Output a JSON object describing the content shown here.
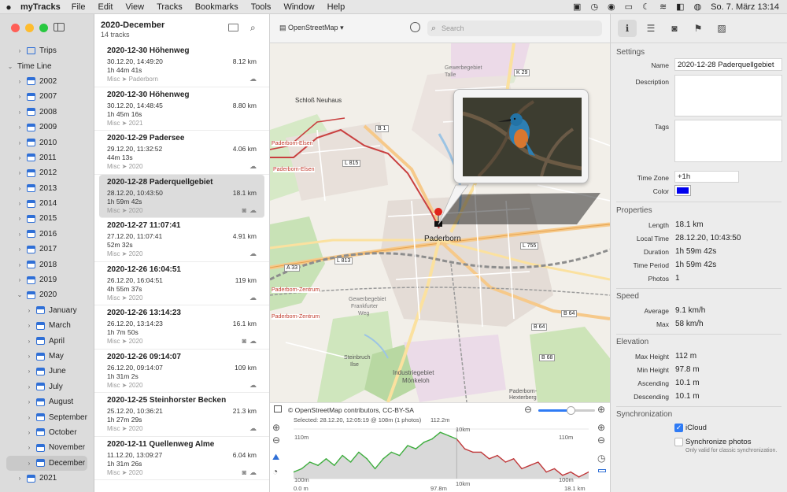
{
  "menubar": {
    "app_name": "myTracks",
    "items": [
      "File",
      "Edit",
      "View",
      "Tracks",
      "Bookmarks",
      "Tools",
      "Window",
      "Help"
    ],
    "clock": "So. 7. März  13:14"
  },
  "sidebar": {
    "items": [
      {
        "label": "Trips",
        "level": 1,
        "icon": "folder",
        "expanded": false
      },
      {
        "label": "Time Line",
        "level": 0,
        "icon": "none",
        "expanded": true
      },
      {
        "label": "2002",
        "level": 1,
        "icon": "calendar",
        "expanded": false
      },
      {
        "label": "2007",
        "level": 1,
        "icon": "calendar",
        "expanded": false
      },
      {
        "label": "2008",
        "level": 1,
        "icon": "calendar",
        "expanded": false
      },
      {
        "label": "2009",
        "level": 1,
        "icon": "calendar",
        "expanded": false
      },
      {
        "label": "2010",
        "level": 1,
        "icon": "calendar",
        "expanded": false
      },
      {
        "label": "2011",
        "level": 1,
        "icon": "calendar",
        "expanded": false
      },
      {
        "label": "2012",
        "level": 1,
        "icon": "calendar",
        "expanded": false
      },
      {
        "label": "2013",
        "level": 1,
        "icon": "calendar",
        "expanded": false
      },
      {
        "label": "2014",
        "level": 1,
        "icon": "calendar",
        "expanded": false
      },
      {
        "label": "2015",
        "level": 1,
        "icon": "calendar",
        "expanded": false
      },
      {
        "label": "2016",
        "level": 1,
        "icon": "calendar",
        "expanded": false
      },
      {
        "label": "2017",
        "level": 1,
        "icon": "calendar",
        "expanded": false
      },
      {
        "label": "2018",
        "level": 1,
        "icon": "calendar",
        "expanded": false
      },
      {
        "label": "2019",
        "level": 1,
        "icon": "calendar",
        "expanded": false
      },
      {
        "label": "2020",
        "level": 1,
        "icon": "calendar",
        "expanded": true
      },
      {
        "label": "January",
        "level": 2,
        "icon": "calendar",
        "expanded": false
      },
      {
        "label": "March",
        "level": 2,
        "icon": "calendar",
        "expanded": false
      },
      {
        "label": "April",
        "level": 2,
        "icon": "calendar",
        "expanded": false
      },
      {
        "label": "May",
        "level": 2,
        "icon": "calendar",
        "expanded": false
      },
      {
        "label": "June",
        "level": 2,
        "icon": "calendar",
        "expanded": false
      },
      {
        "label": "July",
        "level": 2,
        "icon": "calendar",
        "expanded": false
      },
      {
        "label": "August",
        "level": 2,
        "icon": "calendar",
        "expanded": false
      },
      {
        "label": "September",
        "level": 2,
        "icon": "calendar",
        "expanded": false
      },
      {
        "label": "October",
        "level": 2,
        "icon": "calendar",
        "expanded": false
      },
      {
        "label": "November",
        "level": 2,
        "icon": "calendar",
        "expanded": false
      },
      {
        "label": "December",
        "level": 2,
        "icon": "calendar",
        "expanded": false,
        "selected": true
      },
      {
        "label": "2021",
        "level": 1,
        "icon": "calendar",
        "expanded": false
      }
    ]
  },
  "list": {
    "title": "2020-December",
    "subtitle": "14 tracks",
    "tracks": [
      {
        "name": "2020-12-30 Höhenweg",
        "date": "30.12.20, 14:49:20",
        "duration": "1h 44m 41s",
        "category": "Misc ➤ Paderborn",
        "distance": "8.12 km",
        "icons": "cloud"
      },
      {
        "name": "2020-12-30 Höhenweg",
        "date": "30.12.20, 14:48:45",
        "duration": "1h 45m 16s",
        "category": "Misc ➤ 2021",
        "distance": "8.80 km",
        "icons": ""
      },
      {
        "name": "2020-12-29 Padersee",
        "date": "29.12.20, 11:32:52",
        "duration": "44m 13s",
        "category": "Misc ➤ 2020",
        "distance": "4.06 km",
        "icons": "cloud"
      },
      {
        "name": "2020-12-28 Paderquellgebiet",
        "date": "28.12.20, 10:43:50",
        "duration": "1h 59m 42s",
        "category": "Misc ➤ 2020",
        "distance": "18.1 km",
        "icons": "camera cloud",
        "selected": true
      },
      {
        "name": "2020-12-27 11:07:41",
        "date": "27.12.20, 11:07:41",
        "duration": "52m 32s",
        "category": "Misc ➤ 2020",
        "distance": "4.91 km",
        "icons": "cloud"
      },
      {
        "name": "2020-12-26 16:04:51",
        "date": "26.12.20, 16:04:51",
        "duration": "4h 55m 37s",
        "category": "Misc ➤ 2020",
        "distance": "119 km",
        "icons": "cloud"
      },
      {
        "name": "2020-12-26 13:14:23",
        "date": "26.12.20, 13:14:23",
        "duration": "1h 7m 50s",
        "category": "Misc ➤ 2020",
        "distance": "16.1 km",
        "icons": "camera cloud"
      },
      {
        "name": "2020-12-26 09:14:07",
        "date": "26.12.20, 09:14:07",
        "duration": "1h 31m 2s",
        "category": "Misc ➤ 2020",
        "distance": "109 km",
        "icons": "cloud"
      },
      {
        "name": "2020-12-25 Steinhorster Becken",
        "date": "25.12.20, 10:36:21",
        "duration": "1h 27m 29s",
        "category": "Misc ➤ 2020",
        "distance": "21.3 km",
        "icons": "cloud"
      },
      {
        "name": "2020-12-11 Quellenweg Alme",
        "date": "11.12.20, 13:09:27",
        "duration": "1h 31m 26s",
        "category": "Misc ➤ 2020",
        "distance": "6.04 km",
        "icons": "camera cloud"
      }
    ]
  },
  "map": {
    "provider": "OpenStreetMap",
    "search_placeholder": "Search",
    "attribution": "© OpenStreetMap contributors, CC-BY-SA",
    "labels": {
      "schloss": "Schloß Neuhaus",
      "gewerbe1": "Gewerbegebiet",
      "gewerbe1b": "Talle",
      "paderborn": "Paderborn",
      "elsen1": "Paderborn-Elsen",
      "elsen2": "Paderborn-Elsen",
      "zentrum1": "Paderborn-Zentrum",
      "zentrum2": "Paderborn-Zentrum",
      "gewerbe2": "Gewerbegebiet",
      "gewerbe2b": "Frankfurter",
      "gewerbe2c": "Weg",
      "steinbruch": "Steinbruch",
      "steinbruch2": "Ilse",
      "industrie": "Industriegebiet",
      "industrie2": "Mönkeloh",
      "hexenberg": "Paderborn-",
      "hexenberg2": "Hexterberg",
      "k29": "K 29",
      "b1": "B 1",
      "l815": "L 815",
      "l755": "L 755",
      "a33": "A 33",
      "l813": "L 813",
      "b64a": "B 64",
      "b64b": "B 64",
      "b68": "B 68"
    }
  },
  "elevation": {
    "selected": "Selected: 28.12.20, 12:05:19 @ 108m (1 photos)",
    "peak": "112.2m",
    "y_top_left": "110m",
    "y_top_right": "110m",
    "y_bottom_left": "100m",
    "y_bottom_right": "100m",
    "marker_top": "10km",
    "marker_bottom": "10km",
    "x_start": "0.0 m",
    "x_mid": "97.8m",
    "x_end": "18.1 km",
    "colors": {
      "up": "#3fae3f",
      "down": "#c0393b",
      "fill": "#d9d9d9"
    },
    "chart_data": {
      "type": "area",
      "xlabel": "",
      "ylabel": "",
      "xlim": [
        0,
        18.1
      ],
      "ylim": [
        98,
        113
      ],
      "x": [
        0,
        0.5,
        1,
        1.5,
        2,
        2.5,
        3,
        3.5,
        4,
        4.5,
        5,
        5.5,
        6,
        6.5,
        7,
        7.5,
        8,
        8.5,
        9,
        9.5,
        10,
        10.5,
        11,
        11.5,
        12,
        12.5,
        13,
        13.5,
        14,
        14.5,
        15,
        15.5,
        16,
        16.5,
        17,
        17.5,
        18.1
      ],
      "values": [
        100,
        101,
        103,
        102,
        104,
        102,
        105,
        103,
        106,
        104,
        101,
        104,
        106,
        105,
        108,
        107,
        109,
        110,
        112,
        111,
        110,
        107,
        106,
        106,
        104,
        105,
        103,
        104,
        101,
        102,
        103,
        100,
        101,
        99,
        100,
        98.5,
        100
      ]
    }
  },
  "inspector": {
    "tabs": [
      "info",
      "list",
      "camera",
      "flag",
      "photos"
    ],
    "settings_title": "Settings",
    "name_label": "Name",
    "name_value": "2020-12-28 Paderquellgebiet",
    "description_label": "Description",
    "tags_label": "Tags",
    "timezone_label": "Time Zone",
    "timezone_value": "+1h",
    "color_label": "Color",
    "track_color": "#0000ee",
    "properties_title": "Properties",
    "properties": [
      {
        "label": "Length",
        "value": "18.1 km"
      },
      {
        "label": "Local Time",
        "value": "28.12.20, 10:43:50"
      },
      {
        "label": "Duration",
        "value": "1h 59m 42s"
      },
      {
        "label": "Time Period",
        "value": "1h 59m 42s"
      },
      {
        "label": "Photos",
        "value": "1"
      }
    ],
    "speed_title": "Speed",
    "speed": [
      {
        "label": "Average",
        "value": "9.1 km/h"
      },
      {
        "label": "Max",
        "value": "58 km/h"
      }
    ],
    "elevation_title": "Elevation",
    "elevation": [
      {
        "label": "Max Height",
        "value": "112 m"
      },
      {
        "label": "Min Height",
        "value": "97.8 m"
      },
      {
        "label": "Ascending",
        "value": "10.1 m"
      },
      {
        "label": "Descending",
        "value": "10.1 m"
      }
    ],
    "sync_title": "Synchronization",
    "icloud_label": "iCloud",
    "icloud_checked": true,
    "sync_photos_label": "Synchronize photos",
    "sync_photos_checked": false,
    "sync_note": "Only valid for classic synchronization."
  }
}
